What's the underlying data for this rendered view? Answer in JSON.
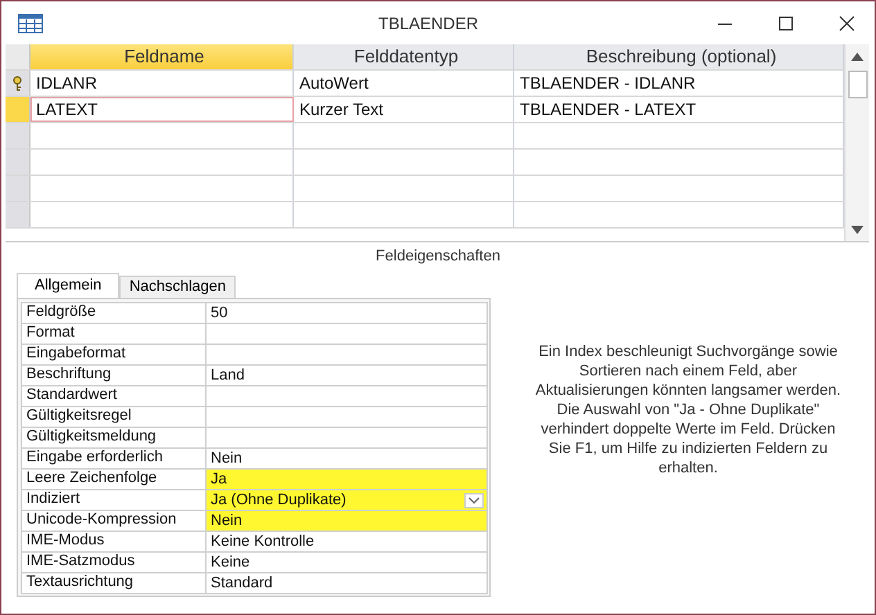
{
  "window": {
    "title": "TBLAENDER"
  },
  "grid": {
    "columns": [
      {
        "label": "Feldname",
        "selected": true
      },
      {
        "label": "Felddatentyp",
        "selected": false
      },
      {
        "label": "Beschreibung (optional)",
        "selected": false
      }
    ],
    "rows": [
      {
        "cells": [
          "IDLANR",
          "AutoWert",
          "TBLAENDER - IDLANR"
        ],
        "primary_key": true,
        "selected": false
      },
      {
        "cells": [
          "LATEXT",
          "Kurzer Text",
          "TBLAENDER - LATEXT"
        ],
        "primary_key": false,
        "selected": true
      }
    ]
  },
  "properties_title": "Feldeigenschaften",
  "tabs": [
    {
      "label": "Allgemein",
      "selected": true
    },
    {
      "label": "Nachschlagen",
      "selected": false
    }
  ],
  "properties": [
    {
      "label": "Feldgröße",
      "value": "50",
      "highlighted": false,
      "kind": "text"
    },
    {
      "label": "Format",
      "highlighted": false,
      "kind": "text"
    },
    {
      "label": "Eingabeformat",
      "highlighted": false,
      "kind": "text"
    },
    {
      "label": "Beschriftung",
      "value": "Land",
      "highlighted": false,
      "kind": "text"
    },
    {
      "label": "Standardwert",
      "highlighted": false,
      "kind": "text"
    },
    {
      "label": "Gültigkeitsregel",
      "highlighted": false,
      "kind": "text"
    },
    {
      "label": "Gültigkeitsmeldung",
      "highlighted": false,
      "kind": "text"
    },
    {
      "label": "Eingabe erforderlich",
      "value": "Nein",
      "highlighted": false,
      "kind": "text"
    },
    {
      "label": "Leere Zeichenfolge",
      "value": "Ja",
      "highlighted": true,
      "kind": "text"
    },
    {
      "label": "Indiziert",
      "value": "Ja (Ohne Duplikate)",
      "highlighted": true,
      "kind": "dropdown"
    },
    {
      "label": "Unicode-Kompression",
      "value": "Nein",
      "highlighted": true,
      "kind": "text"
    },
    {
      "label": "IME-Modus",
      "value": "Keine Kontrolle",
      "highlighted": false,
      "kind": "text"
    },
    {
      "label": "IME-Satzmodus",
      "value": "Keine",
      "highlighted": false,
      "kind": "text"
    },
    {
      "label": "Textausrichtung",
      "value": "Standard",
      "highlighted": false,
      "kind": "text"
    }
  ],
  "help_text": "Ein Index beschleunigt Suchvorgänge sowie Sortieren nach einem Feld, aber Aktualisierungen könnten langsamer werden. Die Auswahl von \"Ja - Ohne Duplikate\" verhindert doppelte Werte im Feld. Drücken Sie F1, um Hilfe zu indizierten Feldern zu erhalten."
}
